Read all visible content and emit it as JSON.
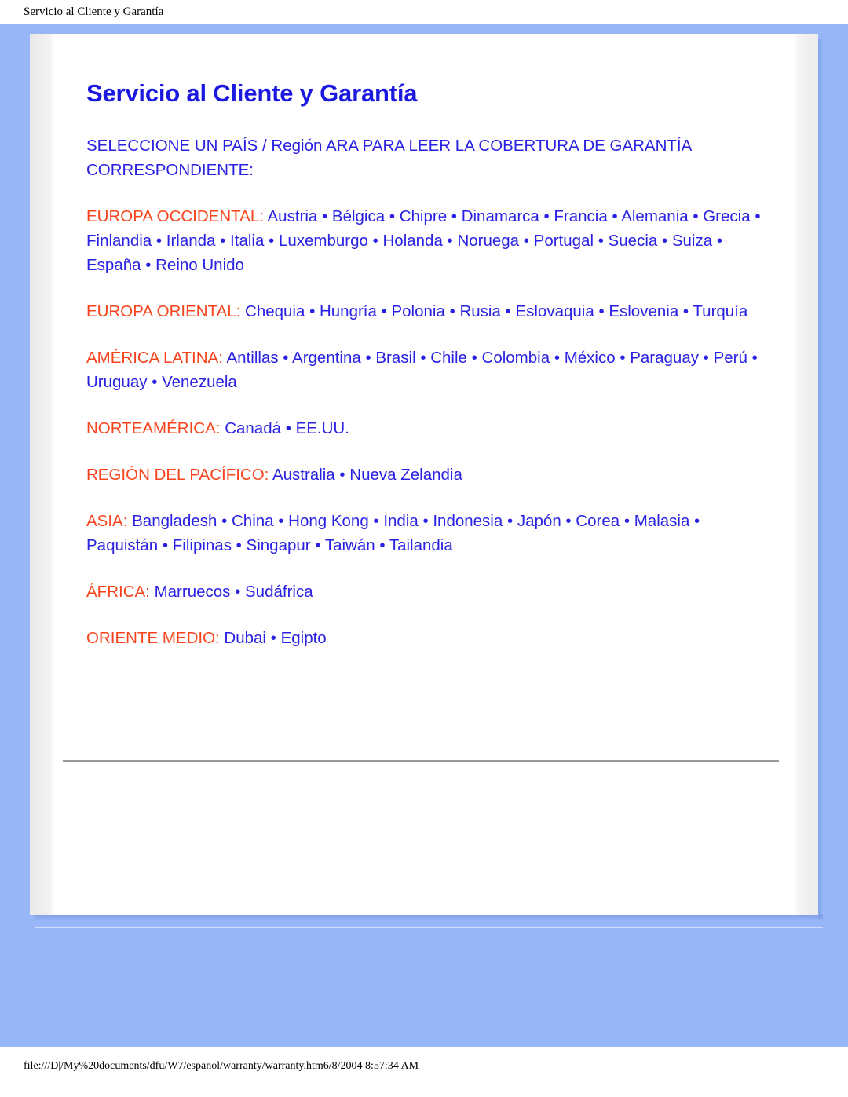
{
  "browser": {
    "print_header": "Servicio al Cliente y Garantía",
    "print_footer": "file:///D|/My%20documents/dfu/W7/espanol/warranty/warranty.htm6/8/2004 8:57:34 AM"
  },
  "colors": {
    "page_background": "#96b6f7",
    "card_background": "#ffffff",
    "gutter": "#eeeeee",
    "title_blue": "#1b18e0",
    "body_blue": "#2a22e3",
    "region_label_red": "#f8441c",
    "rule_gray": "#9a9a9a"
  },
  "document": {
    "title": "Servicio al Cliente y Garantía",
    "intro": "SELECCIONE UN PAÍS / Región ARA PARA LEER LA COBERTURA DE GARANTÍA CORRESPONDIENTE:",
    "separator": " • ",
    "regions": [
      {
        "label": "EUROPA OCCIDENTAL:",
        "countries": [
          "Austria",
          "Bélgica",
          "Chipre",
          "Dinamarca",
          "Francia",
          "Alemania",
          "Grecia",
          "Finlandia",
          "Irlanda",
          "Italia",
          "Luxemburgo",
          "Holanda",
          "Noruega",
          "Portugal",
          "Suecia",
          "Suiza",
          "España",
          "Reino Unido"
        ],
        "text": "Austria • Bélgica • Chipre • Dinamarca • Francia • Alemania • Grecia • Finlandia • Irlanda • Italia • Luxemburgo • Holanda • Noruega • Portugal • Suecia • Suiza • España • Reino Unido"
      },
      {
        "label": "EUROPA ORIENTAL:",
        "countries": [
          "Chequia",
          "Hungría",
          "Polonia",
          "Rusia",
          "Eslovaquia",
          "Eslovenia",
          "Turquía"
        ],
        "text": "Chequia • Hungría • Polonia • Rusia • Eslovaquia • Eslovenia • Turquía"
      },
      {
        "label": "AMÉRICA LATINA:",
        "countries": [
          "Antillas",
          "Argentina",
          "Brasil",
          "Chile",
          "Colombia",
          "México",
          "Paraguay",
          "Perú",
          "Uruguay",
          "Venezuela"
        ],
        "text": "Antillas • Argentina • Brasil • Chile • Colombia • México • Paraguay • Perú • Uruguay • Venezuela"
      },
      {
        "label": "NORTEAMÉRICA:",
        "countries": [
          "Canadá",
          "EE.UU."
        ],
        "text": "Canadá • EE.UU."
      },
      {
        "label": "REGIÓN DEL PACÍFICO:",
        "countries": [
          "Australia",
          "Nueva Zelandia"
        ],
        "text": "Australia • Nueva Zelandia"
      },
      {
        "label": "ASIA:",
        "countries": [
          "Bangladesh",
          "China",
          "Hong Kong",
          "India",
          "Indonesia",
          "Japón",
          "Corea",
          "Malasia",
          "Paquistán",
          "Filipinas",
          "Singapur",
          "Taiwán",
          "Tailandia"
        ],
        "text": "Bangladesh • China • Hong Kong • India • Indonesia • Japón • Corea • Malasia • Paquistán • Filipinas • Singapur • Taiwán • Tailandia"
      },
      {
        "label": "ÁFRICA:",
        "countries": [
          "Marruecos",
          "Sudáfrica"
        ],
        "text": "Marruecos • Sudáfrica"
      },
      {
        "label": "ORIENTE MEDIO:",
        "countries": [
          "Dubai",
          "Egipto"
        ],
        "text": "Dubai • Egipto"
      }
    ]
  }
}
